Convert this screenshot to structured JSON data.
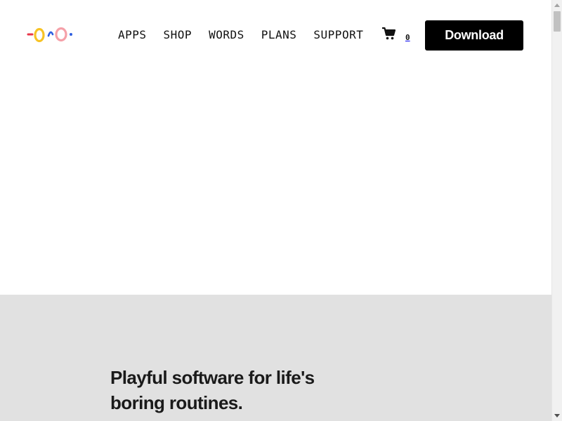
{
  "header": {
    "logo_icon": "colorful-squiggle-logo",
    "nav": [
      {
        "label": "APPS"
      },
      {
        "label": "SHOP"
      },
      {
        "label": "WORDS"
      },
      {
        "label": "PLANS"
      },
      {
        "label": "SUPPORT"
      }
    ],
    "cart": {
      "icon": "cart-icon",
      "count": "0"
    },
    "download_label": "Download"
  },
  "hero": {
    "tagline": "Playful software for life's boring routines."
  },
  "colors": {
    "button_bg": "#000000",
    "hero_bg": "#e1e1e1",
    "logo_red": "#e8374a",
    "logo_yellow": "#f7c325",
    "logo_pink": "#f5a0a8",
    "logo_blue": "#2f5fe0"
  }
}
